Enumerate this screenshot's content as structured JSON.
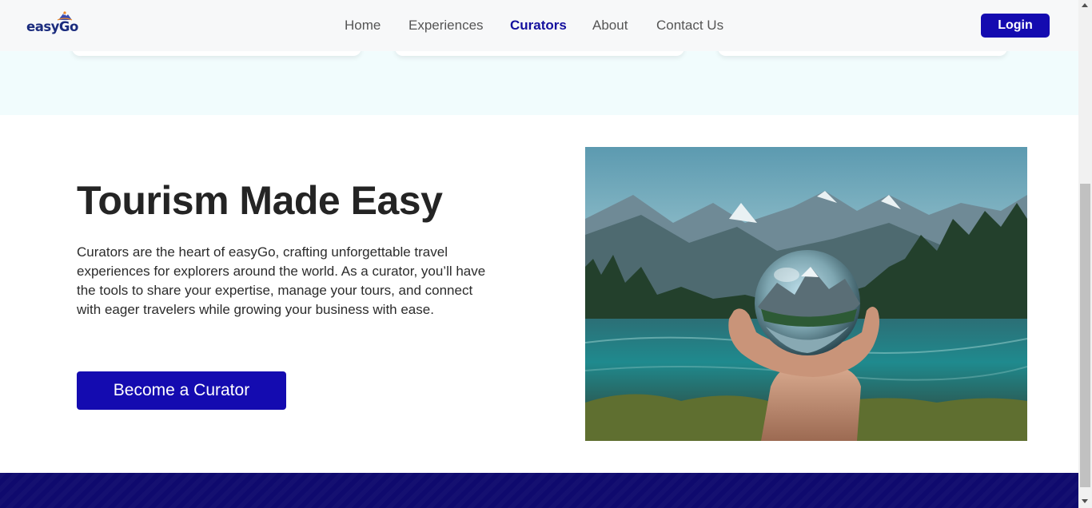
{
  "header": {
    "logo_text": "easyGo",
    "nav": [
      {
        "label": "Home"
      },
      {
        "label": "Experiences"
      },
      {
        "label": "Curators"
      },
      {
        "label": "About"
      },
      {
        "label": "Contact Us"
      }
    ],
    "active_nav": "Curators",
    "login_label": "Login"
  },
  "hero": {
    "title": "Tourism Made Easy",
    "description": "Curators are the heart of easyGo, crafting unforgettable travel experiences for explorers around the world. As a curator, you’ll have the tools to share your expertise, manage your tours, and connect with eager travelers while growing your business with ease.",
    "cta_label": "Become a Curator",
    "image_icon": "lensball-landscape-photo"
  },
  "colors": {
    "brand": "#140bb0",
    "footer": "#0f0a6e",
    "top_band": "#f1fcfd"
  }
}
